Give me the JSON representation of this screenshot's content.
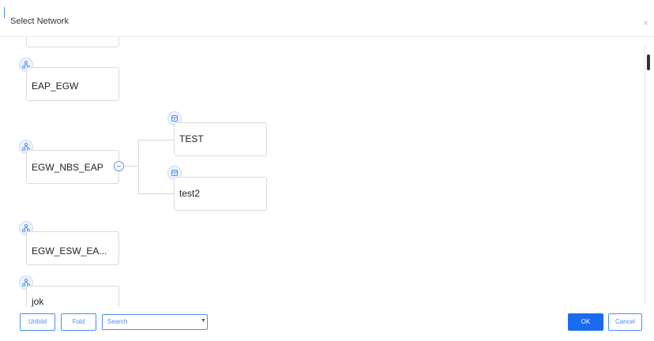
{
  "dialog": {
    "title": "Select Network",
    "close_glyph": "×"
  },
  "tree": {
    "roots": [
      {
        "label": "",
        "icon": "network-icon"
      },
      {
        "label": "EAP_EGW",
        "icon": "network-icon"
      },
      {
        "label": "EGW_NBS_EAP",
        "icon": "network-icon",
        "expanded": true,
        "children": [
          {
            "label": "TEST",
            "icon": "site-icon"
          },
          {
            "label": "test2",
            "icon": "site-icon"
          }
        ]
      },
      {
        "label": "EGW_ESW_EA...",
        "icon": "network-icon"
      },
      {
        "label": "jok",
        "icon": "network-icon"
      }
    ]
  },
  "footer": {
    "unfold_label": "Unfold",
    "fold_label": "Fold",
    "search_placeholder": "Search",
    "ok_label": "OK",
    "cancel_label": "Cancel"
  },
  "colors": {
    "accent": "#1a6bf0",
    "accent_border": "#4b8cf5",
    "node_border": "#dadada"
  }
}
